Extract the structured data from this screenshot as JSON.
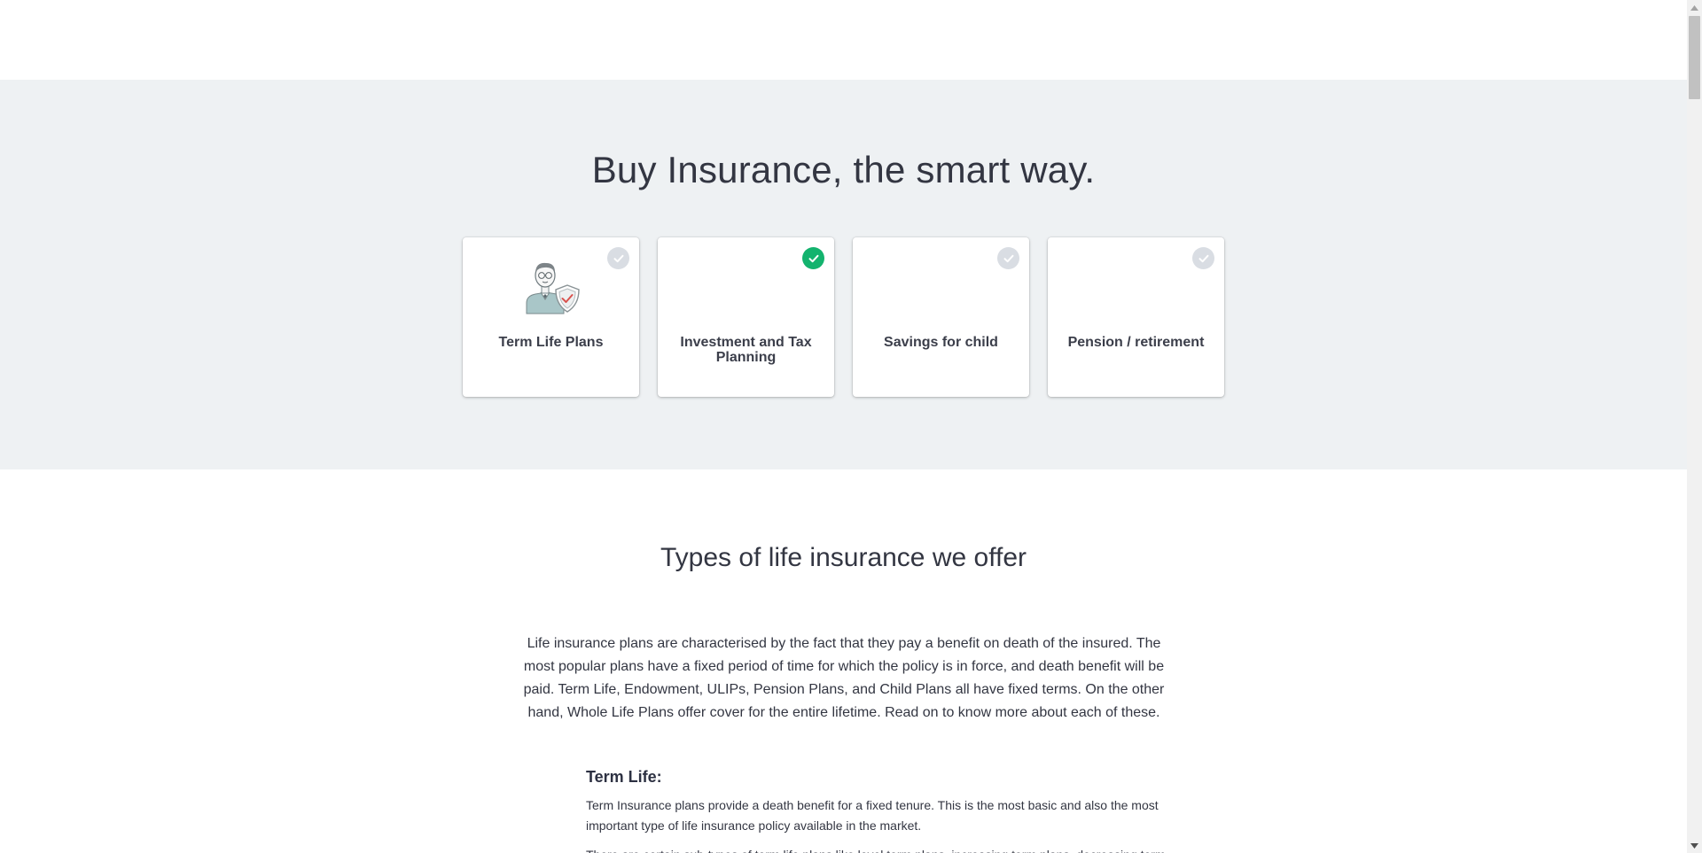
{
  "hero": {
    "title": "Buy Insurance, the smart way.",
    "cards": [
      {
        "label": "Term Life Plans",
        "selected": false,
        "icon": "term-life-illustration"
      },
      {
        "label": "Investment and Tax Planning",
        "selected": true
      },
      {
        "label": "Savings for child",
        "selected": false
      },
      {
        "label": "Pension / retirement",
        "selected": false
      }
    ]
  },
  "section": {
    "title": "Types of life insurance we offer",
    "intro": "Life insurance plans are characterised by the fact that they pay a benefit on death of the insured. The most popular plans have a fixed period of time for which the policy is in force, and death benefit will be paid. Term Life, Endowment, ULIPs, Pension Plans, and Child Plans all have fixed terms. On the other hand, Whole Life Plans offer cover for the entire lifetime. Read on to know more about each of these.",
    "term_life": {
      "title": "Term Life:",
      "para1": "Term Insurance plans provide a death benefit for a fixed tenure. This is the most basic and also the most important type of life insurance policy available in the market.",
      "para2": "There are certain sub-types of term life plans like level term plans, increasing term plans, decreasing term"
    }
  },
  "colors": {
    "hero_bg": "#eef1f3",
    "selected_check": "#13b36e",
    "unselected_check": "#d9dde3"
  }
}
